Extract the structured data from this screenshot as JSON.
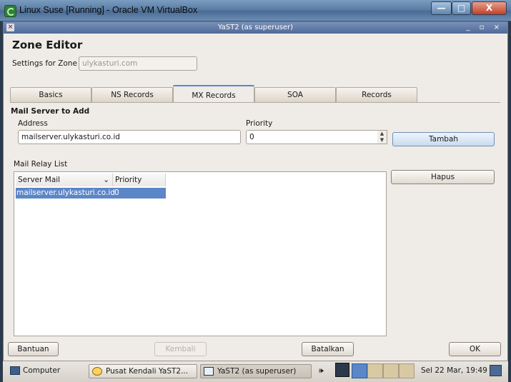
{
  "outer_window": {
    "title": "Linux Suse [Running] - Oracle VM VirtualBox",
    "min_glyph": "—",
    "max_glyph": "□",
    "close_glyph": "X"
  },
  "yast_window": {
    "title": "YaST2 (as superuser)",
    "controls": "_ ▫ ×"
  },
  "heading": "Zone Editor",
  "settings": {
    "label": "Settings for Zone",
    "zone_value": "ulykasturi.com"
  },
  "tabs": [
    {
      "label": "Basics"
    },
    {
      "label": "NS Records"
    },
    {
      "label": "MX Records"
    },
    {
      "label": "SOA"
    },
    {
      "label": "Records"
    }
  ],
  "active_tab": "MX Records",
  "mail_server_section": {
    "title": "Mail Server to Add",
    "address_label": "Address",
    "address_value": "mailserver.ulykasturi.co.id",
    "priority_label": "Priority",
    "priority_value": "0",
    "add_button": "Tambah"
  },
  "relay_list": {
    "title": "Mail Relay List",
    "columns": [
      "Server Mail",
      "Priority"
    ],
    "rows": [
      {
        "server": "mailserver.ulykasturi.co.id",
        "priority": "0"
      }
    ],
    "delete_button": "Hapus"
  },
  "footer_buttons": {
    "help": "Bantuan",
    "back": "Kembali",
    "cancel": "Batalkan",
    "ok": "OK"
  },
  "taskbar": {
    "computer": "Computer",
    "task1": "Pusat Kendali YaST2...",
    "task2": "YaST2 (as superuser)",
    "clock": "Sel 22 Mar, 19:49"
  }
}
